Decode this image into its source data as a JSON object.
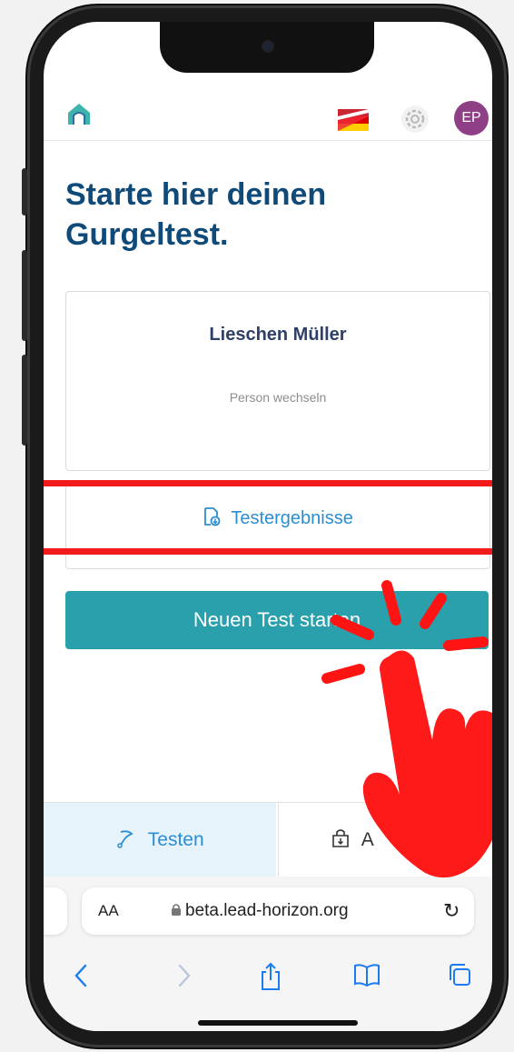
{
  "header": {
    "logo_icon": "house-logo-icon",
    "language_flag": "german-austrian-flag-icon",
    "settings_icon": "gear-icon",
    "avatar_initials": "EP"
  },
  "main": {
    "title_line1": "Starte hier deinen",
    "title_line2": "Gurgeltest.",
    "person_name": "Lieschen Müller",
    "switch_person_label": "Person wechseln",
    "results_label": "Testergebnisse",
    "start_button_label": "Neuen Test starten"
  },
  "tabs": {
    "testen_label": "Testen",
    "other_label_visible": "A"
  },
  "browser": {
    "aa_label": "AA",
    "url": "beta.lead-horizon.org",
    "icons": [
      "back-icon",
      "forward-icon",
      "share-icon",
      "bookmarks-icon",
      "tabs-icon"
    ]
  },
  "colors": {
    "title": "#0f4a78",
    "accent_button": "#29a0ab",
    "link": "#2b8ed3",
    "highlight": "#f21b1b",
    "avatar": "#8e3f86"
  }
}
